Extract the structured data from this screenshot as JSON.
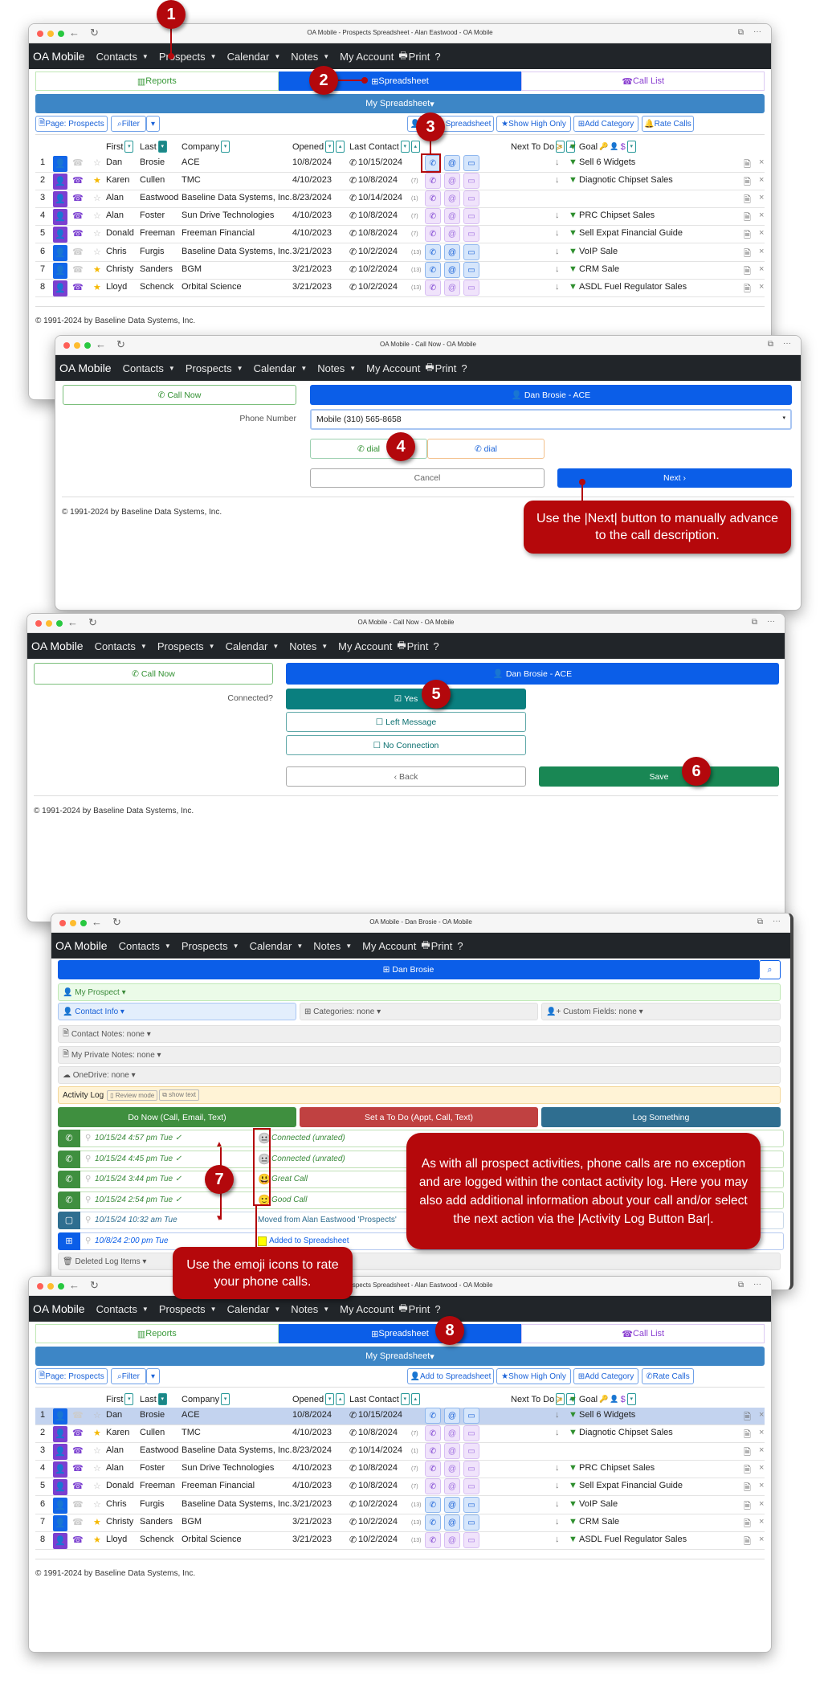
{
  "app": {
    "brand": "OA Mobile",
    "nav": [
      "Contacts",
      "Prospects",
      "Calendar",
      "Notes",
      "My Account",
      "Print",
      "?"
    ],
    "copyright": "© 1991-2024 by Baseline Data Systems, Inc."
  },
  "colors": {
    "navbar": "#212529",
    "primary": "#0b5ee8",
    "spreadsheet_bar": "#3d86c6",
    "teal": "#0a7f7f",
    "save_green": "#198754",
    "callout_red": "#b5080b"
  },
  "spreadsheet": {
    "window_title": "OA Mobile - Prospects Spreadsheet - Alan Eastwood - OA Mobile",
    "tabs": {
      "reports": "Reports",
      "spreadsheet": "Spreadsheet",
      "call_list": "Call List"
    },
    "selector": "My Spreadsheet",
    "toolbar": {
      "page": "Page: Prospects",
      "filter": "Filter",
      "add": "Add to Spreadsheet",
      "high": "Show High Only",
      "category": "Add Category",
      "rate": "Rate Calls"
    },
    "headers": {
      "first": "First",
      "last": "Last",
      "company": "Company",
      "opened": "Opened",
      "last_contact": "Last Contact",
      "next": "Next To Do",
      "goal": "Goal"
    },
    "rows": [
      {
        "n": "1",
        "first": "Dan",
        "last": "Brosie",
        "company": "ACE",
        "opened": "10/8/2024",
        "last_contact": "10/15/2024",
        "days": "",
        "goal": "Sell 6 Widgets",
        "type": "blue",
        "star": false
      },
      {
        "n": "2",
        "first": "Karen",
        "last": "Cullen",
        "company": "TMC",
        "opened": "4/10/2023",
        "last_contact": "10/8/2024",
        "days": "(7)",
        "goal": "Diagnotic Chipset Sales",
        "type": "purple",
        "star": true
      },
      {
        "n": "3",
        "first": "Alan",
        "last": "Eastwood",
        "company": "Baseline Data Systems, Inc.",
        "opened": "8/23/2024",
        "last_contact": "10/14/2024",
        "days": "(1)",
        "goal": "",
        "type": "purple",
        "star": false
      },
      {
        "n": "4",
        "first": "Alan",
        "last": "Foster",
        "company": "Sun Drive Technologies",
        "opened": "4/10/2023",
        "last_contact": "10/8/2024",
        "days": "(7)",
        "goal": "PRC Chipset Sales",
        "type": "purple",
        "star": false
      },
      {
        "n": "5",
        "first": "Donald",
        "last": "Freeman",
        "company": "Freeman Financial",
        "opened": "4/10/2023",
        "last_contact": "10/8/2024",
        "days": "(7)",
        "goal": "Sell Expat Financial Guide",
        "type": "purple",
        "star": false
      },
      {
        "n": "6",
        "first": "Chris",
        "last": "Furgis",
        "company": "Baseline Data Systems, Inc.",
        "opened": "3/21/2023",
        "last_contact": "10/2/2024",
        "days": "(13)",
        "goal": "VoIP Sale",
        "type": "blue",
        "star": false
      },
      {
        "n": "7",
        "first": "Christy",
        "last": "Sanders",
        "company": "BGM",
        "opened": "3/21/2023",
        "last_contact": "10/2/2024",
        "days": "(13)",
        "goal": "CRM Sale",
        "type": "blue",
        "star": true
      },
      {
        "n": "8",
        "first": "Lloyd",
        "last": "Schenck",
        "company": "Orbital Science",
        "opened": "3/21/2023",
        "last_contact": "10/2/2024",
        "days": "(13)",
        "goal": "ASDL Fuel Regulator Sales",
        "type": "purple",
        "star": true
      }
    ]
  },
  "callnow": {
    "window_title": "OA Mobile - Call Now - OA Mobile",
    "call_now": "Call Now",
    "contact": "Dan Brosie - ACE",
    "phone_label": "Phone Number",
    "phone_value": "Mobile (310) 565-8658",
    "dial": "dial",
    "cancel": "Cancel",
    "next": "Next ›",
    "connected_label": "Connected?",
    "yes": "Yes",
    "left_message": "Left Message",
    "no_connection": "No Connection",
    "back": "‹ Back",
    "save": "Save"
  },
  "contact": {
    "window_title": "OA Mobile - Dan Brosie - OA Mobile",
    "name": "Dan Brosie",
    "my_prospect": "My Prospect",
    "contact_info": "Contact Info",
    "categories": "Categories: none",
    "custom_fields": "Custom Fields: none",
    "contact_notes": "Contact Notes: none",
    "private_notes": "My Private Notes: none",
    "onedrive": "OneDrive: none",
    "activity_log": "Activity Log",
    "review_mode": "Review mode",
    "show_text": "show text",
    "do_now": "Do Now (Call, Email, Text)",
    "set_todo": "Set a To Do (Appt, Call, Text)",
    "log_something": "Log Something",
    "log": [
      {
        "kind": "call",
        "date": "10/15/24 4:57 pm Tue ✓",
        "emoji": "neutral",
        "text": "Connected (unrated)"
      },
      {
        "kind": "call",
        "date": "10/15/24 4:45 pm Tue ✓",
        "emoji": "neutral",
        "text": "Connected (unrated)"
      },
      {
        "kind": "call",
        "date": "10/15/24 3:44 pm Tue ✓",
        "emoji": "grin",
        "text": "Great Call"
      },
      {
        "kind": "call",
        "date": "10/15/24 2:54 pm Tue ✓",
        "emoji": "smile",
        "text": "Good Call"
      },
      {
        "kind": "note",
        "date": "10/15/24 10:32 am Tue",
        "emoji": "",
        "text": "Moved from Alan Eastwood 'Prospects'"
      },
      {
        "kind": "sheet",
        "date": "10/8/24 2:00 pm Tue",
        "emoji": "",
        "text": "Added to Spreadsheet"
      }
    ],
    "deleted": "Deleted Log Items"
  },
  "callouts": {
    "steps": [
      "1",
      "2",
      "3",
      "4",
      "5",
      "6",
      "7",
      "8"
    ],
    "next_tip": "Use the |Next| button to manually advance to the call description.",
    "log_tip": "As with all prospect activities, phone calls are no exception and are logged within the contact activity log.  Here you may also add additional information about your call and/or select the next action via the |Activity Log Button Bar|.",
    "emoji_tip": "Use the emoji icons to rate your phone calls."
  }
}
